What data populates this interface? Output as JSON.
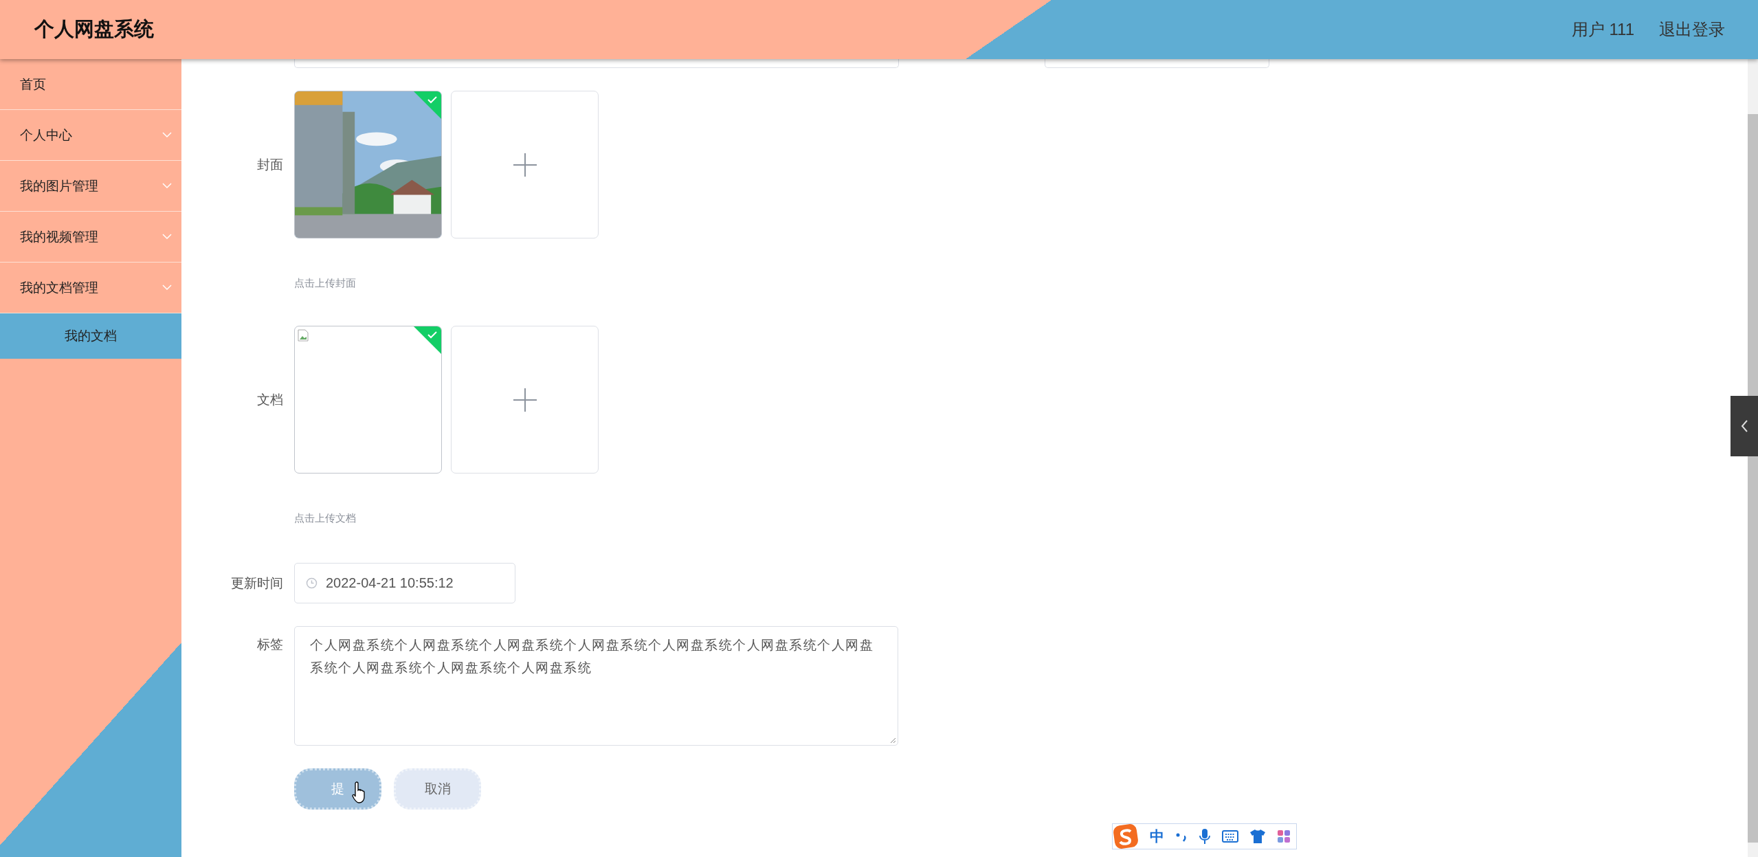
{
  "header": {
    "title": "个人网盘系统",
    "user": "用户 111",
    "logout": "退出登录"
  },
  "sidebar": {
    "items": [
      {
        "label": "首页",
        "kind": "link",
        "selected": false
      },
      {
        "label": "个人中心",
        "kind": "submenu",
        "selected": false
      },
      {
        "label": "我的图片管理",
        "kind": "submenu",
        "selected": false
      },
      {
        "label": "我的视频管理",
        "kind": "submenu",
        "selected": false
      },
      {
        "label": "我的文档管理",
        "kind": "submenu",
        "selected": false,
        "children": [
          {
            "label": "我的文档",
            "selected": true
          }
        ]
      }
    ]
  },
  "form": {
    "fields": [
      {
        "kind": "upload",
        "label": "封面",
        "uploaded": true,
        "hint": "点击上传封面"
      },
      {
        "kind": "upload",
        "label": "文档",
        "preview": {
          "kind": "broken"
        },
        "uploaded": true,
        "hint": "点击上传文档"
      },
      {
        "kind": "datetime",
        "label": "更新时间",
        "value": "2022-04-21 10:55:12"
      },
      {
        "kind": "textarea",
        "label": "标签",
        "value": "个人网盘系统个人网盘系统个人网盘系统个人网盘系统个人网盘系统个人网盘系统个人网盘系统个人网盘系统个人网盘系统个人网盘系统"
      }
    ],
    "buttons": [
      {
        "label": "提",
        "kind": "primary"
      },
      {
        "label": "取消",
        "kind": "secondary"
      }
    ]
  },
  "ime_toolbar": {
    "mode": "中"
  }
}
